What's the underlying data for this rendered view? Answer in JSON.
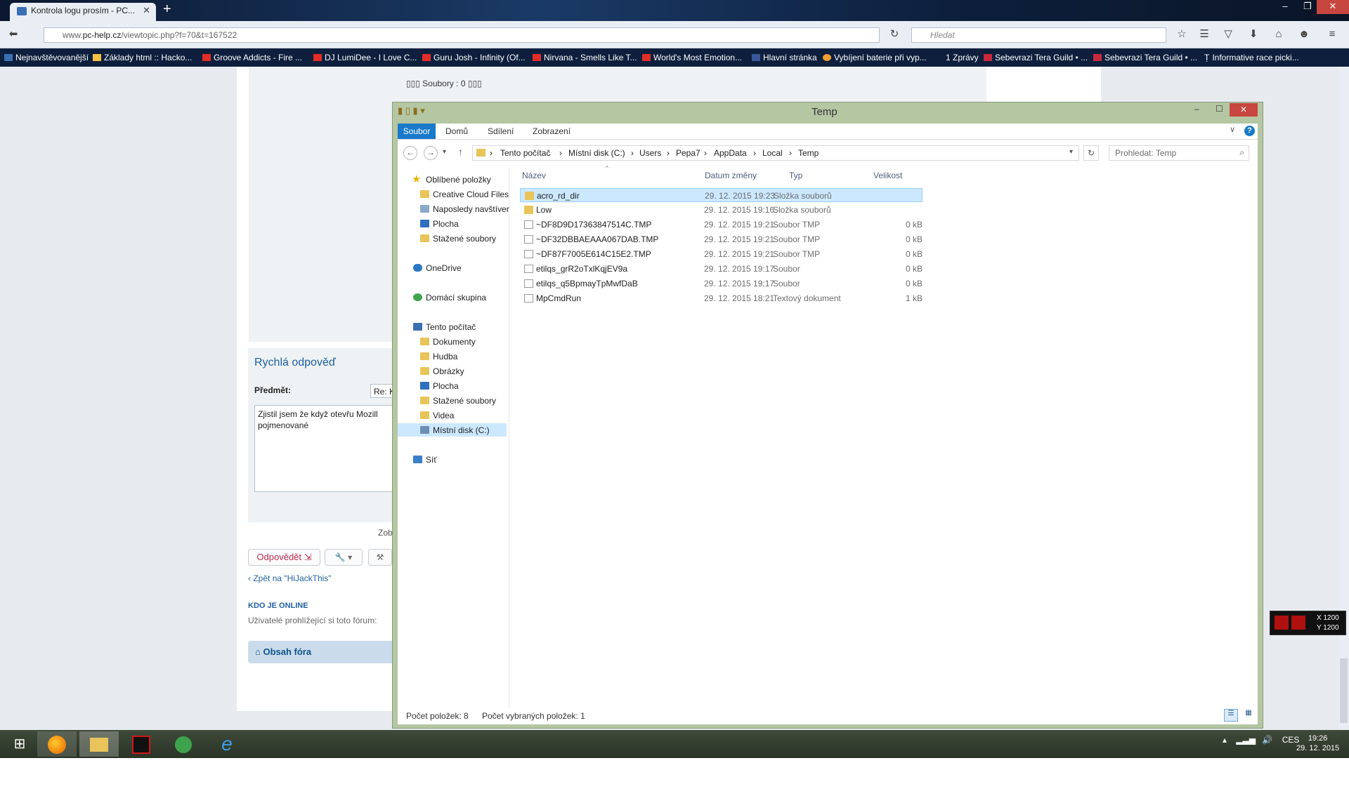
{
  "browser": {
    "tab_title": "Kontrola logu prosím - PC...",
    "url_prefix": "www.",
    "url_host": "pc-help.cz",
    "url_path": "/viewtopic.php?f=70&t=167522",
    "search_placeholder": "Hledat",
    "bookmarks": [
      "Nejnavštěvovanější",
      "Základy html :: Hacko...",
      "Groove Addicts - Fire ...",
      "DJ LumiDee - I Love C...",
      "Guru Josh - Infinity (Of...",
      "Nirvana - Smells Like T...",
      "World's Most Emotion...",
      "Hlavní stránka",
      "Vybíjení baterie při vyp...",
      "1 Zprávy",
      "Sebevrazi Tera Guild • ...",
      "Sebevrazi Tera Guild • ...",
      "Informative race picki..."
    ]
  },
  "forum": {
    "attachments": "▯▯▯ Soubory : 0 ▯▯▯",
    "quick_reply_title": "Rychlá odpověď",
    "subject_label": "Předmět:",
    "subject_value": "Re: K",
    "message_text": "Zjistil jsem že když otevřu Mozill pojmenované",
    "zob": "Zob",
    "reply_button": "Odpovědět",
    "back_link": "Zpět na \"HiJackThis\"",
    "online_heading": "KDO JE ONLINE",
    "online_text": "Uživatelé prohlížející si toto fórum: ",
    "forum_index": "Obsah fóra"
  },
  "explorer": {
    "title": "Temp",
    "ribbon_tabs": [
      "Soubor",
      "Domů",
      "Sdílení",
      "Zobrazení"
    ],
    "breadcrumb": [
      "Tento počítač",
      "Místní disk (C:)",
      "Users",
      "Pepa7",
      "AppData",
      "Local",
      "Temp"
    ],
    "search_placeholder": "Prohledat: Temp",
    "columns": [
      "Název",
      "Datum změny",
      "Typ",
      "Velikost"
    ],
    "nav": {
      "favorites": "Oblíbené položky",
      "fav_items": [
        "Creative Cloud Files",
        "Naposledy navštíver",
        "Plocha",
        "Stažené soubory"
      ],
      "onedrive": "OneDrive",
      "homegroup": "Domácí skupina",
      "this_pc": "Tento počítač",
      "pc_items": [
        "Dokumenty",
        "Hudba",
        "Obrázky",
        "Plocha",
        "Stažené soubory",
        "Videa",
        "Místní disk (C:)"
      ],
      "network": "Síť"
    },
    "files": [
      {
        "name": "acro_rd_dir",
        "date": "29. 12. 2015 19:23",
        "type": "Složka souborů",
        "size": ""
      },
      {
        "name": "Low",
        "date": "29. 12. 2015 19:16",
        "type": "Složka souborů",
        "size": ""
      },
      {
        "name": "~DF8D9D17363847514C.TMP",
        "date": "29. 12. 2015 19:21",
        "type": "Soubor TMP",
        "size": "0 kB"
      },
      {
        "name": "~DF32DBBAEAAA067DAB.TMP",
        "date": "29. 12. 2015 19:21",
        "type": "Soubor TMP",
        "size": "0 kB"
      },
      {
        "name": "~DF87F7005E614C15E2.TMP",
        "date": "29. 12. 2015 19:21",
        "type": "Soubor TMP",
        "size": "0 kB"
      },
      {
        "name": "etilqs_grR2oTxlKqjEV9a",
        "date": "29. 12. 2015 19:17",
        "type": "Soubor",
        "size": "0 kB"
      },
      {
        "name": "etilqs_q5BpmayTpMwfDaB",
        "date": "29. 12. 2015 19:17",
        "type": "Soubor",
        "size": "0 kB"
      },
      {
        "name": "MpCmdRun",
        "date": "29. 12. 2015 18:21",
        "type": "Textový dokument",
        "size": "1 kB"
      }
    ],
    "status_count": "Počet položek: 8",
    "status_selected": "Počet vybraných položek: 1"
  },
  "widget": {
    "x": "X 1200",
    "y": "Y 1200"
  },
  "taskbar": {
    "language": "CES",
    "time": "19:26",
    "date": "29. 12. 2015"
  },
  "colors": {
    "accent": "#1979ca",
    "selection": "#cce8ff",
    "forum_link": "#1f5f9f"
  }
}
